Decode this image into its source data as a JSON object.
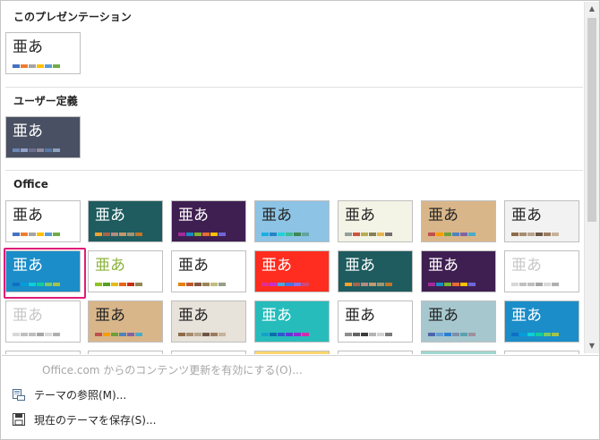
{
  "sections": {
    "this_presentation": "このプレゼンテーション",
    "user_defined": "ユーザー定義",
    "office": "Office"
  },
  "glyph": "亜あ",
  "themes": {
    "this_presentation": [
      {
        "bg": "#ffffff",
        "text": "#262626",
        "swatches": [
          "#4472c4",
          "#ed7d31",
          "#a5a5a5",
          "#ffc000",
          "#5b9bd5",
          "#70ad47"
        ]
      }
    ],
    "user_defined": [
      {
        "bg": "#4a5063",
        "text": "#ffffff",
        "swatches": [
          "#6b87b5",
          "#8fa1c9",
          "#6d6e8e",
          "#8b8ba3",
          "#5779a8",
          "#8da0bd"
        ]
      }
    ],
    "office": [
      {
        "bg": "#ffffff",
        "text": "#262626",
        "swatches": [
          "#4472c4",
          "#ed7d31",
          "#a5a5a5",
          "#ffc000",
          "#5b9bd5",
          "#70ad47"
        ]
      },
      {
        "bg": "#1e5c5f",
        "text": "#ffffff",
        "swatches": [
          "#f0a22e",
          "#a5644e",
          "#b58b80",
          "#c3986d",
          "#a19574",
          "#c17529"
        ]
      },
      {
        "bg": "#3f1f51",
        "text": "#ffffff",
        "swatches": [
          "#a5299b",
          "#1a8bc0",
          "#7eb233",
          "#e66c37",
          "#ffc000",
          "#6d67d7"
        ]
      },
      {
        "bg": "#8dc3e4",
        "text": "#262626",
        "swatches": [
          "#1cade4",
          "#2683c6",
          "#27ced7",
          "#42ba97",
          "#3e8853",
          "#62a39f"
        ]
      },
      {
        "bg": "#f3f3e6",
        "text": "#262626",
        "swatches": [
          "#93a299",
          "#cf543f",
          "#b5ae53",
          "#848058",
          "#e8b54d",
          "#786c71"
        ]
      },
      {
        "bg": "#d9b68a",
        "text": "#262626",
        "swatches": [
          "#c0504d",
          "#f59e00",
          "#6f9e3b",
          "#4f81bd",
          "#8064a2",
          "#4bacc6"
        ]
      },
      {
        "bg": "#f2f2f2",
        "text": "#262626",
        "swatches": [
          "#8e6b4a",
          "#a58c6e",
          "#b7a48e",
          "#6f5643",
          "#9b7c61",
          "#c7b299"
        ]
      },
      {
        "bg": "#1b8dc9",
        "text": "#ffffff",
        "swatches": [
          "#0f6fc6",
          "#009dd9",
          "#0bd0d9",
          "#10cf9b",
          "#7cca62",
          "#a5c249"
        ]
      },
      {
        "bg": "#ffffff",
        "text": "#8cb43c",
        "swatches": [
          "#90c226",
          "#54a021",
          "#e6b91e",
          "#e76618",
          "#c42f1a",
          "#918655"
        ]
      },
      {
        "bg": "#ffffff",
        "text": "#262626",
        "swatches": [
          "#e48312",
          "#bd582c",
          "#865640",
          "#9b8357",
          "#c2bc80",
          "#94a088"
        ]
      },
      {
        "bg": "#ff2d1f",
        "text": "#ffffff",
        "swatches": [
          "#e32d91",
          "#c830cc",
          "#4ea6dc",
          "#4775e7",
          "#8971e1",
          "#d54773"
        ]
      },
      {
        "bg": "#1e5c5f",
        "text": "#ffffff",
        "swatches": [
          "#f0a22e",
          "#a5644e",
          "#b58b80",
          "#c3986d",
          "#a19574",
          "#c17529"
        ]
      },
      {
        "bg": "#3f1f51",
        "text": "#ffffff",
        "swatches": [
          "#a5299b",
          "#1a8bc0",
          "#7eb233",
          "#e66c37",
          "#ffc000",
          "#6d67d7"
        ]
      },
      {
        "bg": "#ffffff",
        "text": "#c8c8c8",
        "swatches": [
          "#d8d8d8",
          "#c0c0c0",
          "#bfbfbf",
          "#a6a6a6",
          "#d9d9d9",
          "#b0b0b0"
        ]
      },
      {
        "bg": "#ffffff",
        "text": "#c8c8c8",
        "swatches": [
          "#d8d8d8",
          "#c0c0c0",
          "#bfbfbf",
          "#a6a6a6",
          "#d9d9d9",
          "#b0b0b0"
        ]
      },
      {
        "bg": "#d9b68a",
        "text": "#262626",
        "swatches": [
          "#c0504d",
          "#f59e00",
          "#6f9e3b",
          "#4f81bd",
          "#8064a2",
          "#4bacc6"
        ]
      },
      {
        "bg": "#e7e2da",
        "text": "#262626",
        "swatches": [
          "#8e6b4a",
          "#a58c6e",
          "#b7a48e",
          "#6f5643",
          "#9b7c61",
          "#c7b299"
        ]
      },
      {
        "bg": "#27bcbc",
        "text": "#ffffff",
        "swatches": [
          "#16a1c9",
          "#0d6eaa",
          "#2c59d1",
          "#5f39d5",
          "#8f2ad5",
          "#d12da9"
        ]
      },
      {
        "bg": "#ffffff",
        "text": "#262626",
        "swatches": [
          "#8e8e8e",
          "#646464",
          "#3c3c3c",
          "#b4b4b4",
          "#d2d2d2",
          "#7a7a7a"
        ]
      },
      {
        "bg": "#a7c7cf",
        "text": "#262626",
        "swatches": [
          "#4a66ac",
          "#629dd1",
          "#297fd5",
          "#7f8fa9",
          "#5aa2ae",
          "#9d90a0"
        ]
      },
      {
        "bg": "#1b8dc9",
        "text": "#ffffff",
        "swatches": [
          "#0f6fc6",
          "#009dd9",
          "#0bd0d9",
          "#10cf9b",
          "#7cca62",
          "#a5c249"
        ]
      }
    ],
    "office_partial": [
      {
        "bg": "#ffffff"
      },
      {
        "bg": "#ffffff"
      },
      {
        "bg": "#ffffff"
      },
      {
        "bg": "#ffd770"
      },
      {
        "bg": "#ffffff"
      },
      {
        "bg": "#9fd7d0"
      },
      {
        "bg": "#ffffff"
      }
    ]
  },
  "menu": {
    "enable_updates": "Office.com からのコンテンツ更新を有効にする(O)...",
    "browse_themes": "テーマの参照(M)...",
    "save_theme": "現在のテーマを保存(S)..."
  },
  "icons": {
    "browse": "folder-icon",
    "save": "save-icon",
    "scroll_up": "chevron-up-icon",
    "scroll_down": "chevron-down-icon"
  },
  "colors": {
    "selection": "#e01c79"
  }
}
